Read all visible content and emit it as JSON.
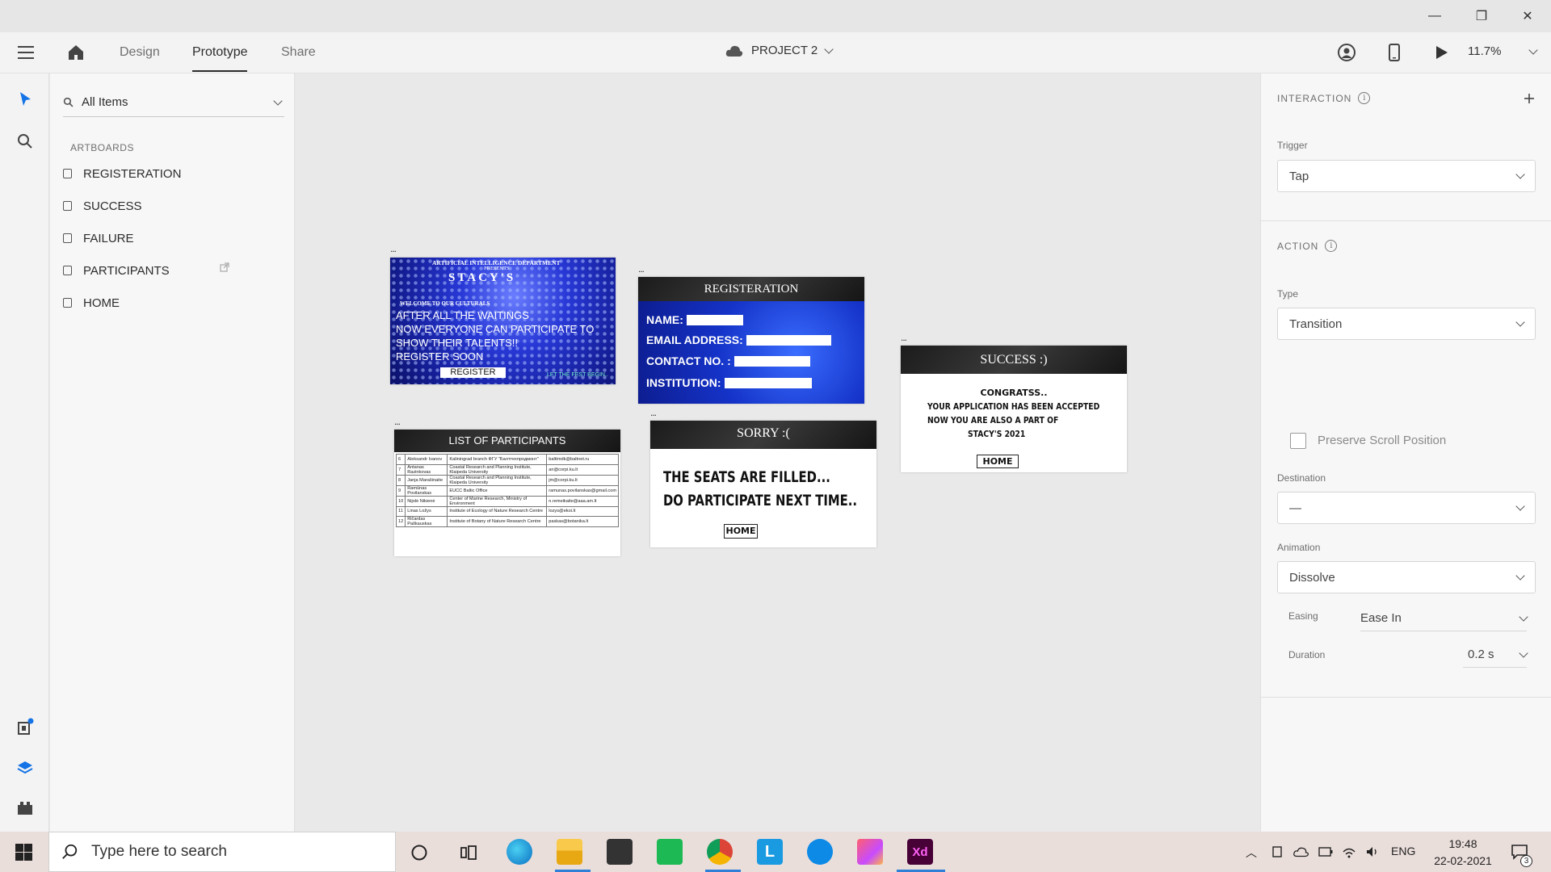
{
  "window": {
    "minimize": "—",
    "restore": "❐",
    "close": "✕"
  },
  "appbar": {
    "tabs": [
      "Design",
      "Prototype",
      "Share"
    ],
    "active_tab": "Prototype",
    "project_name": "PROJECT 2",
    "zoom": "11.7%"
  },
  "layers": {
    "filter": "All Items",
    "section": "ARTBOARDS",
    "items": [
      "REGISTERATION",
      "SUCCESS",
      "FAILURE",
      "PARTICIPANTS",
      "HOME"
    ]
  },
  "canvas": {
    "artboard_marker": "...",
    "home": {
      "dept": "ARTIFICIAL INTELLIGENCE DEPARTMENT",
      "presents": "PRESENTS",
      "title": "STACY'S",
      "welcome": "WELCOME TO OUR CULTURALS",
      "line1": "AFTER ALL THE WAITINGS",
      "line2": "NOW EVERYONE CAN PARTICIPATE TO",
      "line3": "SHOW THEIR TALENTS!!",
      "line4": "REGISTER SOON",
      "register_button": "REGISTER",
      "tagline": "LET THE FEST BEGIN.."
    },
    "registration": {
      "title": "REGISTERATION",
      "fields": [
        "NAME:",
        "EMAIL ADDRESS:",
        "CONTACT NO. :",
        "INSTITUTION:"
      ]
    },
    "success": {
      "title": "SUCCESS :)",
      "line1": "CONGRATSS..",
      "line2": "YOUR APPLICATION HAS BEEN ACCEPTED",
      "line3": "NOW YOU ARE ALSO  A PART OF",
      "line4": "STACY'S 2021",
      "home_button": "HOME"
    },
    "participants": {
      "title": "LIST OF PARTICIPANTS",
      "rows": [
        [
          "6",
          "Aleksandr Ivanov",
          "Kaliningrad branch ФГУ \"Балттехпродмонт\"",
          "balttmdk@baltnet.ru"
        ],
        [
          "7",
          "Antanas Razinkovas",
          "Coastal Research and Planning Institute, Klaipeda University",
          "an@corpi.ku.lt"
        ],
        [
          "8",
          "Janja Marašinaite",
          "Coastal Research and Planning Institute, Klaipeda University",
          "jm@corpi.ku.lt"
        ],
        [
          "9",
          "Ramūnas Povilanskas",
          "EUCC Baltic Office",
          "ramunas.povilanskas@gmail.com"
        ],
        [
          "10",
          "Nijolė Nikienė",
          "Center of Marine Research, Ministry of Environment",
          "n.remeikaite@aaa.am.lt"
        ],
        [
          "11",
          "Linas Ložys",
          "Institute of Ecology of Nature Research Centre",
          "lozys@ekoi.lt"
        ],
        [
          "12",
          "Ričardas Paškauskas",
          "Institute of Botany of Nature Research Centre",
          "paskas@botanika.lt"
        ]
      ]
    },
    "failure": {
      "title": "SORRY :(",
      "line1": "THE SEATS ARE FILLED...",
      "line2": "DO PARTICIPATE NEXT TIME..",
      "home_button": "HOME"
    }
  },
  "props": {
    "interaction_heading": "INTERACTION",
    "trigger_label": "Trigger",
    "trigger_value": "Tap",
    "action_heading": "ACTION",
    "type_label": "Type",
    "type_value": "Transition",
    "preserve_scroll": "Preserve Scroll Position",
    "destination_label": "Destination",
    "destination_value": "—",
    "animation_label": "Animation",
    "animation_value": "Dissolve",
    "easing_label": "Easing",
    "easing_value": "Ease In",
    "duration_label": "Duration",
    "duration_value": "0.2 s"
  },
  "taskbar": {
    "search_placeholder": "Type here to search",
    "language": "ENG",
    "time": "19:48",
    "date": "22-02-2021",
    "notification_count": "3"
  },
  "colors": {
    "accent_blue": "#2f7fd6",
    "xd_pink": "#ff2bc2",
    "xd_bg": "#470137"
  }
}
